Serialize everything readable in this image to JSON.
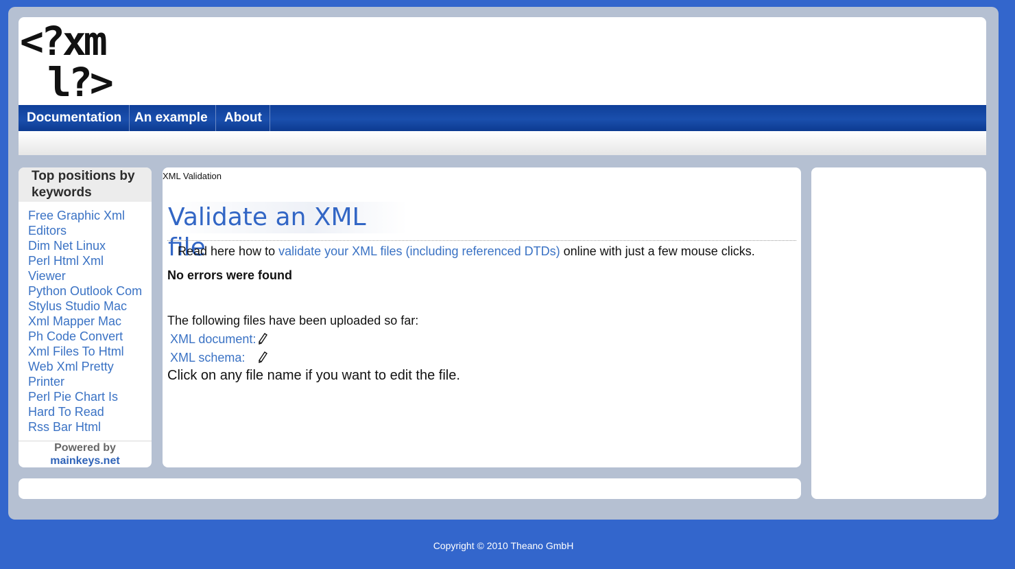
{
  "logo": {
    "line1": "<?xm",
    "line2": "l?>"
  },
  "nav": {
    "items": [
      "Documentation",
      "An example",
      "About"
    ]
  },
  "sidebar": {
    "heading": "Top positions by keywords",
    "keywords": [
      "Free Graphic Xml",
      "Editors",
      "Dim Net Linux",
      "Perl Html Xml",
      "Viewer",
      "Python Outlook Com",
      "Stylus Studio Mac",
      "Xml Mapper Mac",
      "Ph Code Convert",
      "Xml Files To Html",
      "Web Xml Pretty",
      "Printer",
      "Perl Pie Chart Is",
      "Hard To Read",
      "Rss Bar Html"
    ],
    "powered_by": "Powered by",
    "powered_link": "mainkeys.net"
  },
  "main": {
    "breadcrumb": "XML Validation",
    "title": "Validate an XML file",
    "intro_before": "Read here how to ",
    "intro_link": "validate your XML files (including referenced DTDs)",
    "intro_after": " online with just a few mouse clicks.",
    "status": "No errors were found",
    "uploaded_heading": "The following files have been uploaded so far:",
    "files": [
      {
        "label": "XML document:",
        "icon": "pencil-icon"
      },
      {
        "label": "XML schema:",
        "icon": "pencil-icon"
      }
    ],
    "click_info": "Click on any file name if you want to edit the file."
  },
  "footer": {
    "copyright": "Copyright © 2010 Theano GmbH"
  },
  "colors": {
    "page_bg": "#3366cc",
    "nav_bg": "#1a4fad",
    "link": "#3a72c4",
    "title": "#3266c5"
  }
}
